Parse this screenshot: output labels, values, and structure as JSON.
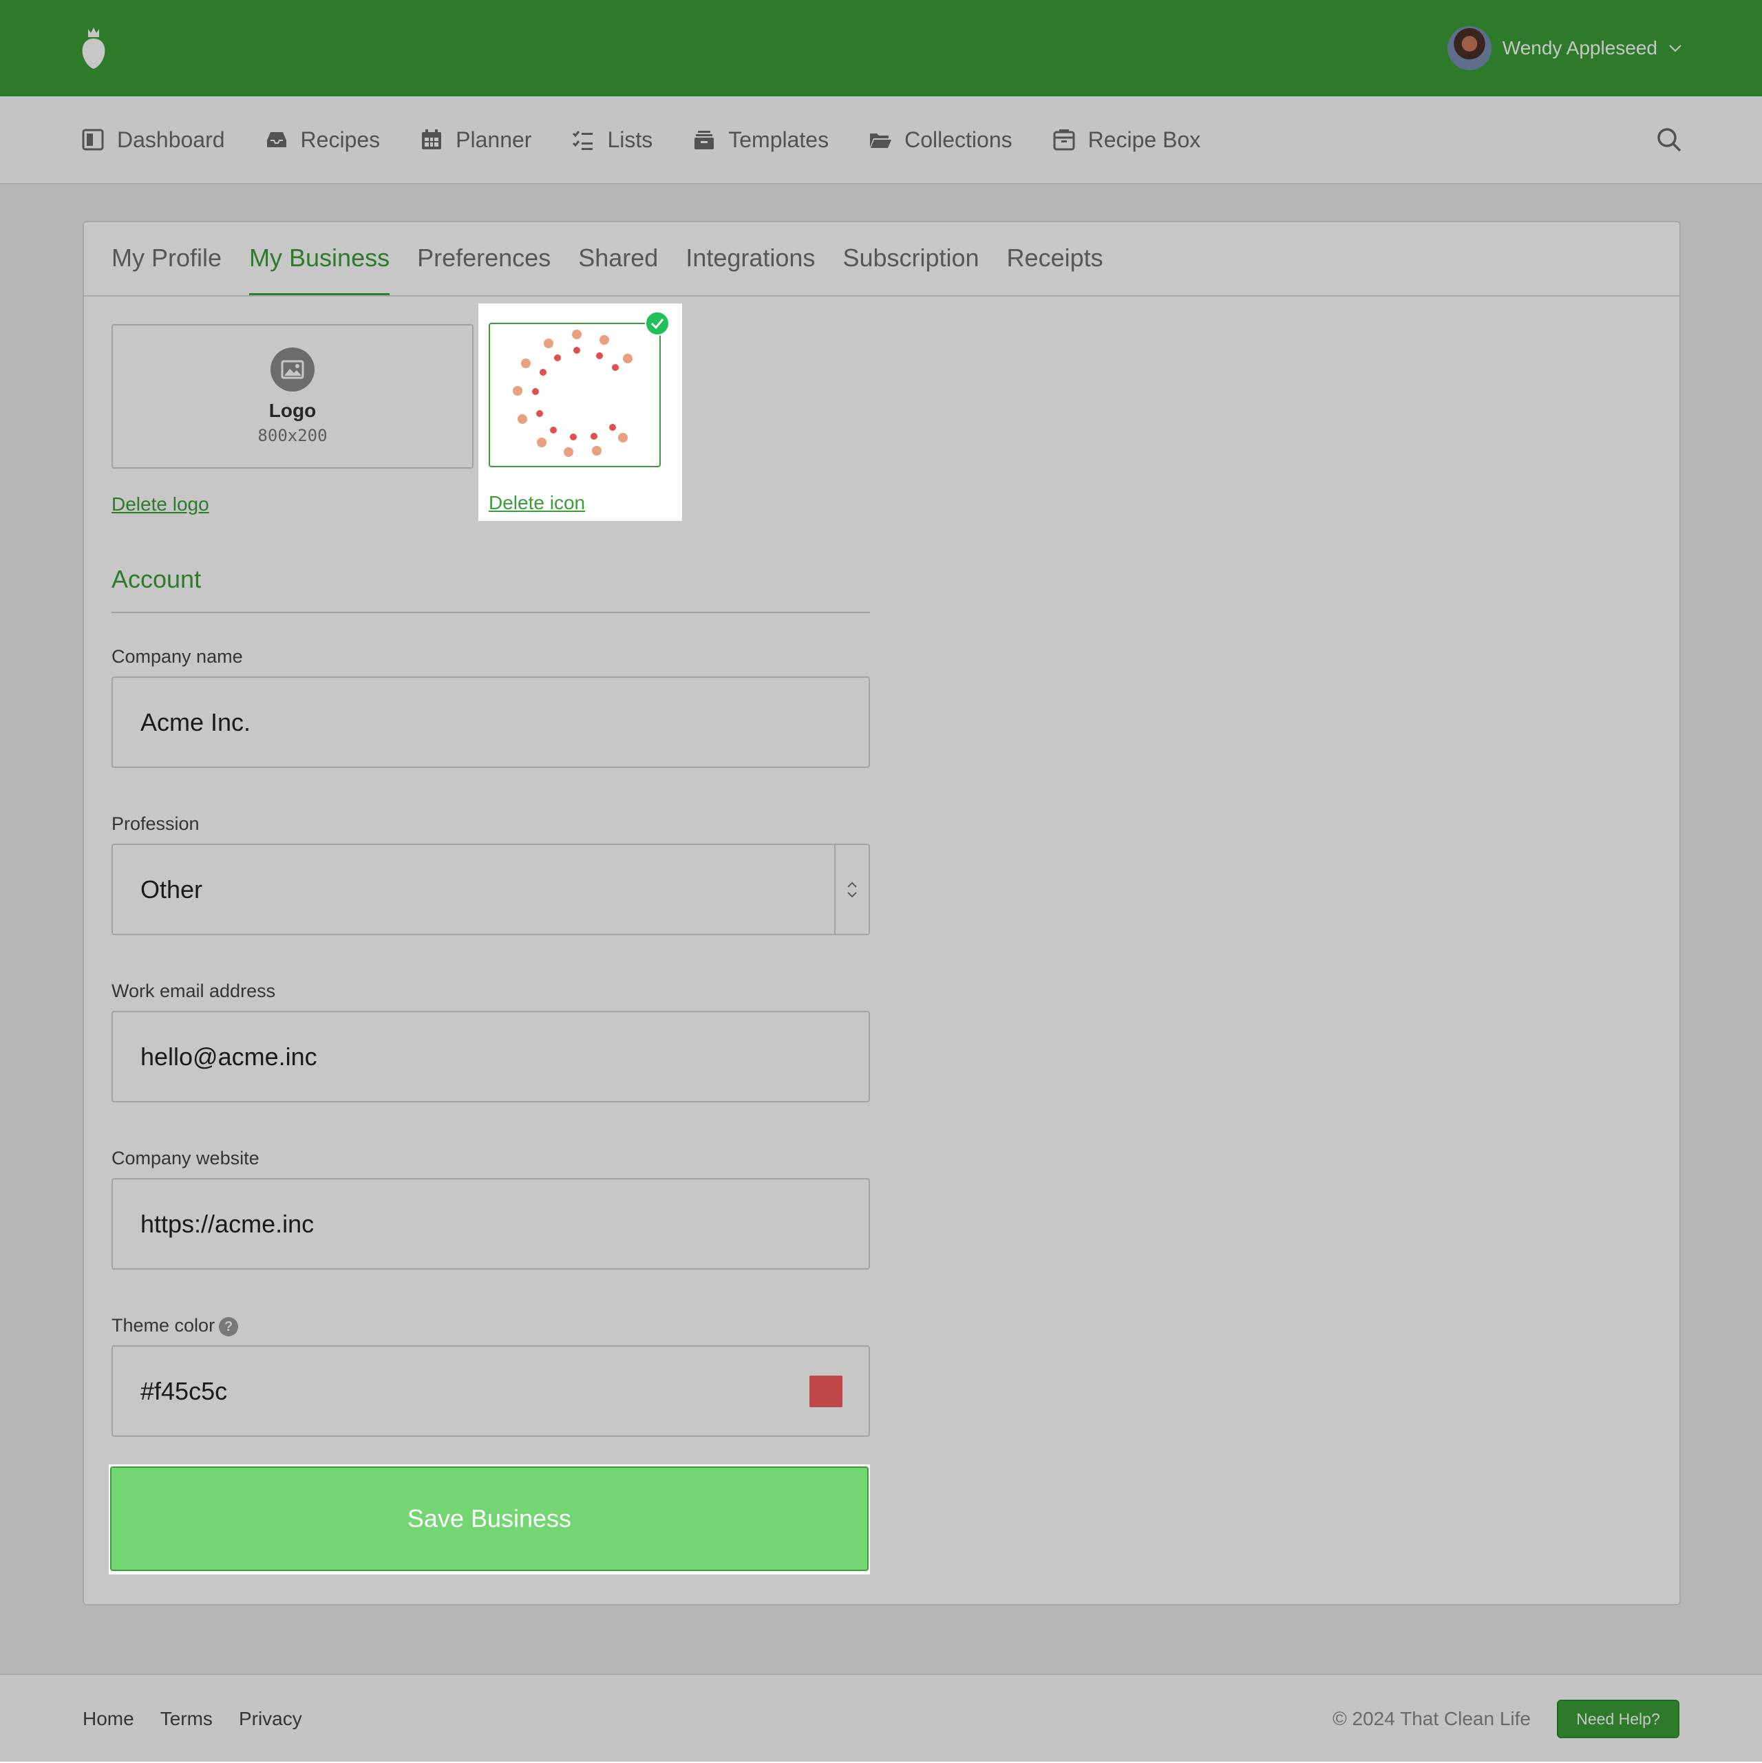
{
  "topbar": {
    "brand_logo": "strawberry-logo",
    "user_name": "Wendy Appleseed"
  },
  "nav": {
    "items": [
      {
        "label": "Dashboard",
        "icon": "dashboard-icon"
      },
      {
        "label": "Recipes",
        "icon": "inbox-icon"
      },
      {
        "label": "Planner",
        "icon": "calendar-icon"
      },
      {
        "label": "Lists",
        "icon": "checklist-icon"
      },
      {
        "label": "Templates",
        "icon": "stack-icon"
      },
      {
        "label": "Collections",
        "icon": "folder-icon"
      },
      {
        "label": "Recipe Box",
        "icon": "box-icon"
      }
    ]
  },
  "tabs": [
    {
      "label": "My Profile"
    },
    {
      "label": "My Business",
      "active": true
    },
    {
      "label": "Preferences"
    },
    {
      "label": "Shared"
    },
    {
      "label": "Integrations"
    },
    {
      "label": "Subscription"
    },
    {
      "label": "Receipts"
    }
  ],
  "uploads": {
    "logo_title": "Logo",
    "logo_size": "800x200",
    "delete_logo": "Delete logo",
    "delete_icon": "Delete icon"
  },
  "account": {
    "section_title": "Account",
    "company_name_label": "Company name",
    "company_name_value": "Acme Inc.",
    "profession_label": "Profession",
    "profession_value": "Other",
    "email_label": "Work email address",
    "email_value": "hello@acme.inc",
    "website_label": "Company website",
    "website_value": "https://acme.inc",
    "theme_label": "Theme color",
    "theme_value": "#f45c5c",
    "save_label": "Save Business"
  },
  "colors": {
    "brand_green": "#3a9e37",
    "theme_color": "#f45c5c"
  },
  "footer": {
    "links": [
      "Home",
      "Terms",
      "Privacy"
    ],
    "copyright": "© 2024 That Clean Life",
    "help_label": "Need Help?"
  }
}
